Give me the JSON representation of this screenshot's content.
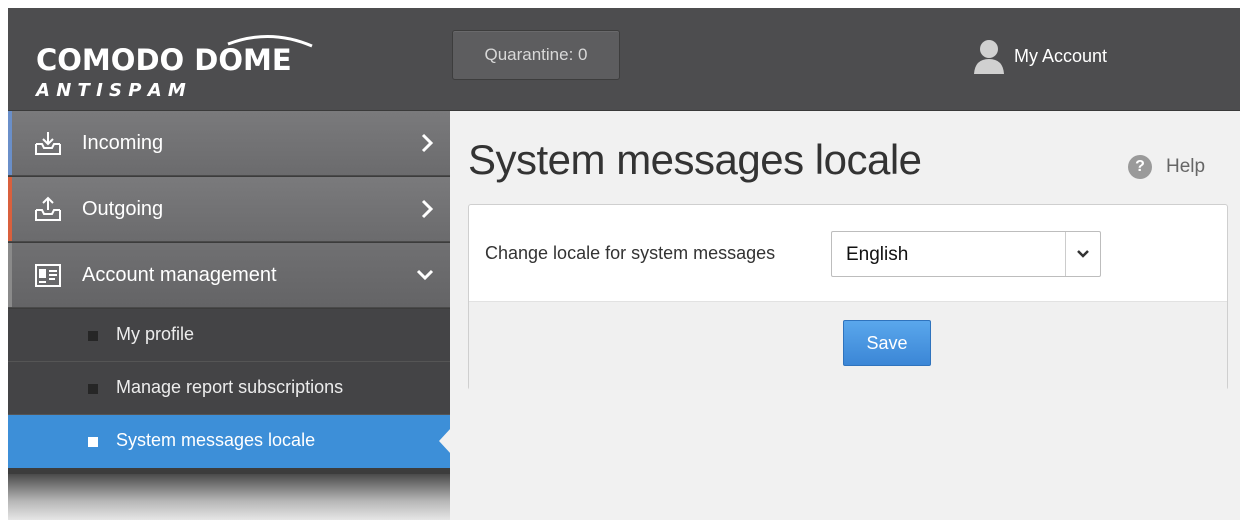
{
  "header": {
    "logo_text_top": "COMODO DOME",
    "logo_text_bottom": "A N T I S P A M",
    "quarantine_label": "Quarantine: 0",
    "account_label": "My Account"
  },
  "sidebar": {
    "items": [
      {
        "label": "Incoming",
        "icon": "inbox-download-icon",
        "accent": "#6a8fc9"
      },
      {
        "label": "Outgoing",
        "icon": "outbox-upload-icon",
        "accent": "#d9603d"
      },
      {
        "label": "Account management",
        "icon": "id-card-icon",
        "accent": "#8a8a8a"
      }
    ],
    "subitems": [
      {
        "label": "My profile"
      },
      {
        "label": "Manage report subscriptions"
      },
      {
        "label": "System messages locale",
        "active": true
      }
    ]
  },
  "main": {
    "title": "System messages locale",
    "help_label": "Help",
    "field_label": "Change locale for system messages",
    "locale_value": "English",
    "save_label": "Save"
  },
  "colors": {
    "header_bg": "#4d4d4f",
    "active_item": "#3d8fd8",
    "save_button": "#4a97e2"
  }
}
